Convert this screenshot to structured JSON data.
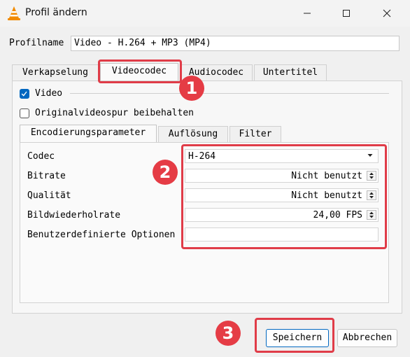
{
  "window": {
    "title": "Profil ändern"
  },
  "profile": {
    "label": "Profilname",
    "value": "Video - H.264 + MP3 (MP4)"
  },
  "main_tabs": [
    {
      "label": "Verkapselung"
    },
    {
      "label": "Videocodec"
    },
    {
      "label": "Audiocodec"
    },
    {
      "label": "Untertitel"
    }
  ],
  "video": {
    "video_checkbox_label": "Video",
    "video_checked": true,
    "keep_original_label": "Originalvideospur beibehalten",
    "keep_original_checked": false
  },
  "sub_tabs": [
    {
      "label": "Encodierungsparameter"
    },
    {
      "label": "Auflösung"
    },
    {
      "label": "Filter"
    }
  ],
  "params": {
    "codec_label": "Codec",
    "codec_value": "H-264",
    "bitrate_label": "Bitrate",
    "bitrate_value": "Nicht benutzt",
    "quality_label": "Qualität",
    "quality_value": "Nicht benutzt",
    "framerate_label": "Bildwiederholrate",
    "framerate_value": "24,00 FPS",
    "custom_options_label": "Benutzerdefinierte Optionen",
    "custom_options_value": ""
  },
  "buttons": {
    "save": "Speichern",
    "cancel": "Abbrechen"
  },
  "annotations": {
    "badge1": "1",
    "badge2": "2",
    "badge3": "3"
  },
  "colors": {
    "highlight": "#e03c48",
    "badge": "#e53c45",
    "accent": "#0067c0"
  }
}
